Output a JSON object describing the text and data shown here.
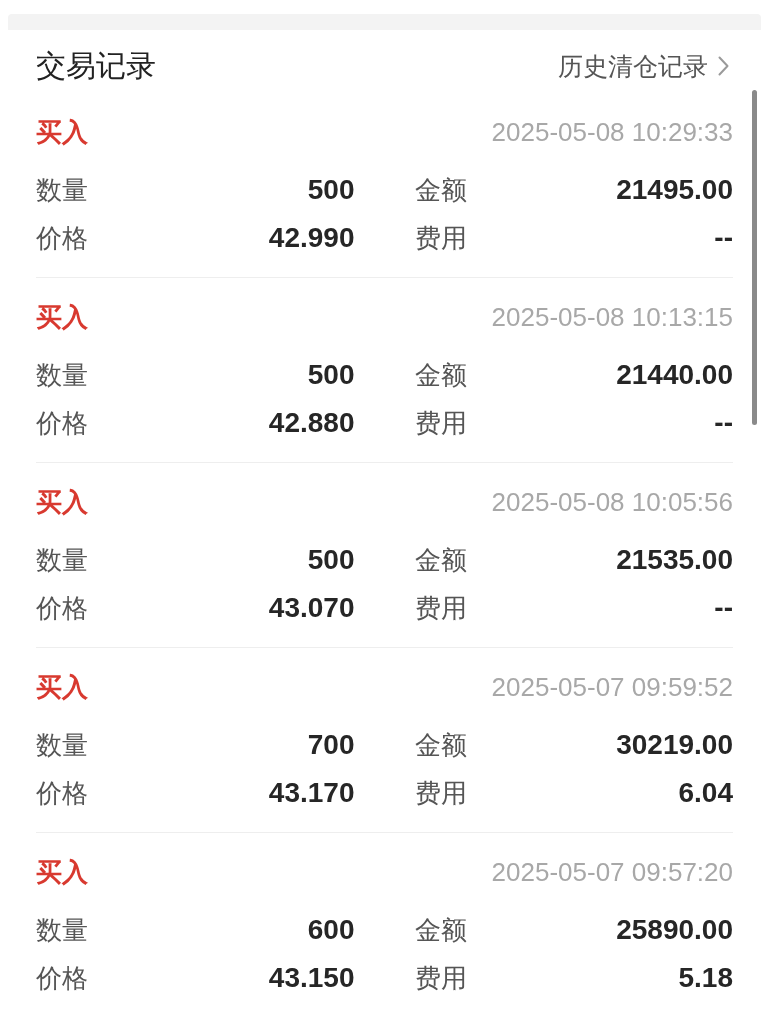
{
  "section_title": "交易记录",
  "history_link": {
    "label": "历史清仓记录"
  },
  "records": [
    {
      "side": "买入",
      "time": "2025-05-08 10:29:33",
      "fields": [
        {
          "label": "数量",
          "value": "500"
        },
        {
          "label": "金额",
          "value": "21495.00"
        },
        {
          "label": "价格",
          "value": "42.990"
        },
        {
          "label": "费用",
          "value": "--"
        }
      ]
    },
    {
      "side": "买入",
      "time": "2025-05-08 10:13:15",
      "fields": [
        {
          "label": "数量",
          "value": "500"
        },
        {
          "label": "金额",
          "value": "21440.00"
        },
        {
          "label": "价格",
          "value": "42.880"
        },
        {
          "label": "费用",
          "value": "--"
        }
      ]
    },
    {
      "side": "买入",
      "time": "2025-05-08 10:05:56",
      "fields": [
        {
          "label": "数量",
          "value": "500"
        },
        {
          "label": "金额",
          "value": "21535.00"
        },
        {
          "label": "价格",
          "value": "43.070"
        },
        {
          "label": "费用",
          "value": "--"
        }
      ]
    },
    {
      "side": "买入",
      "time": "2025-05-07 09:59:52",
      "fields": [
        {
          "label": "数量",
          "value": "700"
        },
        {
          "label": "金额",
          "value": "30219.00"
        },
        {
          "label": "价格",
          "value": "43.170"
        },
        {
          "label": "费用",
          "value": "6.04"
        }
      ]
    },
    {
      "side": "买入",
      "time": "2025-05-07 09:57:20",
      "fields": [
        {
          "label": "数量",
          "value": "600"
        },
        {
          "label": "金额",
          "value": "25890.00"
        },
        {
          "label": "价格",
          "value": "43.150"
        },
        {
          "label": "费用",
          "value": "5.18"
        }
      ]
    }
  ]
}
